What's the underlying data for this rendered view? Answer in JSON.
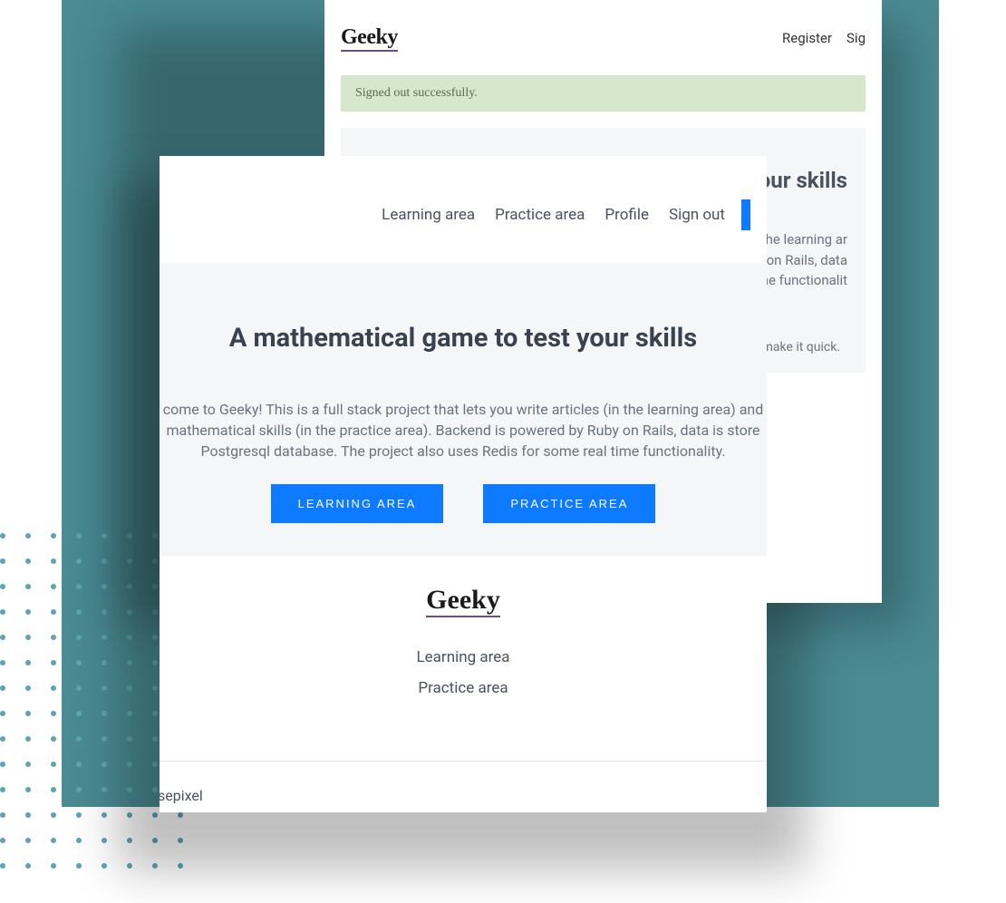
{
  "brand": {
    "name": "Geeky"
  },
  "back": {
    "nav": {
      "register": "Register",
      "signin": "Sig"
    },
    "alert": "Signed out successfully.",
    "title": " your skills",
    "desc_line1": "cles (in the learning ar",
    "desc_line2": " by Ruby on Rails, data",
    "desc_line3": "e real time functionalit",
    "footer_text": "t to make it quick."
  },
  "front": {
    "nav": {
      "learning": "Learning area",
      "practice": "Practice area",
      "profile": "Profile",
      "signout": "Sign out"
    },
    "title": "A mathematical game to test your skills",
    "desc_line1": "come to Geeky! This is a full stack project that lets you write articles (in the learning area) and",
    "desc_line2": " mathematical skills (in the practice area). Backend is powered by Ruby on Rails, data is store",
    "desc_line3": "Postgresql database. The project also uses Redis for some real time functionality.",
    "buttons": {
      "learning": "LEARNING AREA",
      "practice": "PRACTICE AREA"
    },
    "footer": {
      "learning": "Learning area",
      "practice": "Practice area"
    },
    "credit": "sepixel"
  }
}
